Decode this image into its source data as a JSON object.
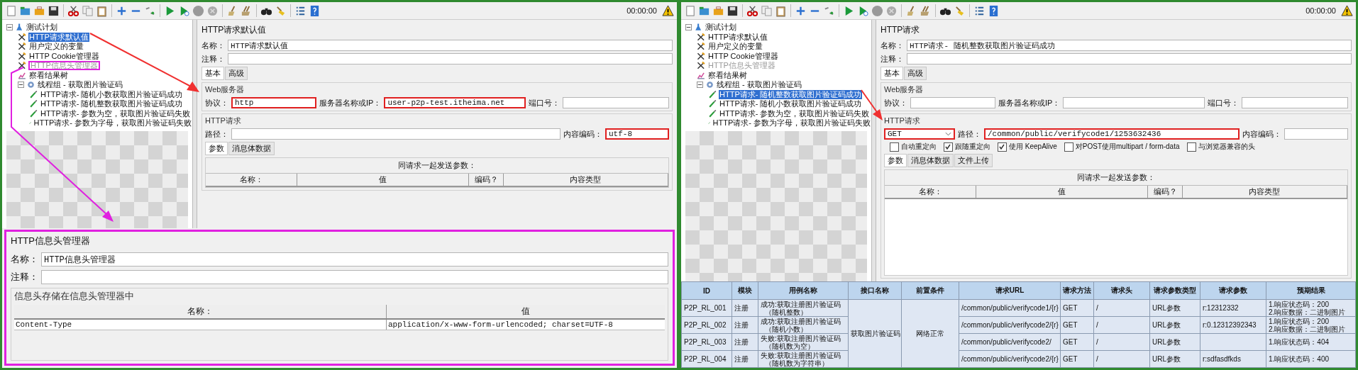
{
  "windows": [
    {
      "toolbar": {
        "timer": "00:00:00"
      },
      "tree": [
        {
          "label": "测试计划",
          "kind": "plan",
          "expanded": true,
          "selected": false,
          "disabled": false,
          "highlighted": false,
          "children": [
            {
              "label": "HTTP请求默认值",
              "kind": "config",
              "selected": true,
              "disabled": false,
              "highlighted": false
            },
            {
              "label": "用户定义的变量",
              "kind": "config",
              "selected": false,
              "disabled": false,
              "highlighted": false
            },
            {
              "label": "HTTP Cookie管理器",
              "kind": "config",
              "selected": false,
              "disabled": false,
              "highlighted": false
            },
            {
              "label": "HTTP信息头管理器",
              "kind": "config",
              "selected": false,
              "disabled": true,
              "highlighted": true
            },
            {
              "label": "察看结果树",
              "kind": "listener",
              "selected": false,
              "disabled": false,
              "highlighted": false
            },
            {
              "label": "线程组 - 获取图片验证码",
              "kind": "thread_group",
              "expanded": true,
              "selected": false,
              "disabled": false,
              "highlighted": false,
              "children": [
                {
                  "label": "HTTP请求- 随机小数获取图片验证码成功",
                  "kind": "sampler",
                  "selected": false,
                  "disabled": false,
                  "highlighted": false
                },
                {
                  "label": "HTTP请求- 随机整数获取图片验证码成功",
                  "kind": "sampler",
                  "selected": false,
                  "disabled": false,
                  "highlighted": false
                },
                {
                  "label": "HTTP请求- 参数为空，获取图片验证码失败",
                  "kind": "sampler",
                  "selected": false,
                  "disabled": false,
                  "highlighted": false
                },
                {
                  "label": "HTTP请求- 参数为字母，获取图片验证码失败",
                  "kind": "sampler",
                  "selected": false,
                  "disabled": false,
                  "highlighted": false
                }
              ]
            }
          ]
        }
      ],
      "editor": {
        "title": "HTTP请求默认值",
        "name_label": "名称：",
        "name_value": "HTTP请求默认值",
        "comment_label": "注释：",
        "tabs": [
          {
            "label": "基本",
            "selected": true
          },
          {
            "label": "高级",
            "selected": false
          }
        ],
        "web_server": {
          "legend": "Web服务器",
          "fields": [
            {
              "label": "协议：",
              "value": "http",
              "highlighted": true
            },
            {
              "label": "服务器名称或IP：",
              "value": "user-p2p-test.itheima.net",
              "highlighted": true
            },
            {
              "label": "端口号：",
              "highlighted": false
            }
          ]
        },
        "http_request": {
          "legend": "HTTP请求",
          "path": {
            "label": "路径：",
            "highlighted": false
          },
          "encoding": {
            "label": "内容编码：",
            "value": "utf-8",
            "highlighted": true
          }
        },
        "param_tabs": [
          {
            "label": "参数",
            "selected": true
          },
          {
            "label": "消息体数据",
            "selected": false
          }
        ],
        "params_table": {
          "caption": "同请求一起发送参数：",
          "columns": [
            "名称：",
            "值",
            "编码？",
            "内容类型"
          ]
        }
      },
      "header_manager": {
        "highlighted": true,
        "title": "HTTP信息头管理器",
        "name_label": "名称：",
        "name_value": "HTTP信息头管理器",
        "comment_label": "注释：",
        "legend": "信息头存储在信息头管理器中",
        "columns": [
          "名称：",
          "值"
        ],
        "rows": [
          [
            "Content-Type",
            "application/x-www-form-urlencoded; charset=UTF-8"
          ]
        ]
      }
    },
    {
      "toolbar": {
        "timer": "00:00:00"
      },
      "tree": [
        {
          "label": "测试计划",
          "kind": "plan",
          "expanded": true,
          "selected": false,
          "disabled": false,
          "highlighted": false,
          "children": [
            {
              "label": "HTTP请求默认值",
              "kind": "config",
              "selected": false,
              "disabled": false,
              "highlighted": false
            },
            {
              "label": "用户定义的变量",
              "kind": "config",
              "selected": false,
              "disabled": false,
              "highlighted": false
            },
            {
              "label": "HTTP Cookie管理器",
              "kind": "config",
              "selected": false,
              "disabled": false,
              "highlighted": false
            },
            {
              "label": "HTTP信息头管理器",
              "kind": "config",
              "selected": false,
              "disabled": true,
              "highlighted": false
            },
            {
              "label": "察看结果树",
              "kind": "listener",
              "selected": false,
              "disabled": false,
              "highlighted": false
            },
            {
              "label": "线程组 - 获取图片验证码",
              "kind": "thread_group",
              "expanded": true,
              "selected": false,
              "disabled": false,
              "highlighted": false,
              "children": [
                {
                  "label": "HTTP请求- 随机整数获取图片验证码成功",
                  "kind": "sampler",
                  "selected": true,
                  "disabled": false,
                  "highlighted": false
                },
                {
                  "label": "HTTP请求- 随机小数获取图片验证码成功",
                  "kind": "sampler",
                  "selected": false,
                  "disabled": false,
                  "highlighted": false
                },
                {
                  "label": "HTTP请求- 参数为空，获取图片验证码失败",
                  "kind": "sampler",
                  "selected": false,
                  "disabled": false,
                  "highlighted": false
                },
                {
                  "label": "HTTP请求- 参数为字母，获取图片验证码失败",
                  "kind": "sampler",
                  "selected": false,
                  "disabled": false,
                  "highlighted": false
                }
              ]
            }
          ]
        }
      ],
      "editor": {
        "title": "HTTP请求",
        "name_label": "名称：",
        "name_value": "HTTP请求- 随机整数获取图片验证码成功",
        "comment_label": "注释：",
        "tabs": [
          {
            "label": "基本",
            "selected": true
          },
          {
            "label": "高级",
            "selected": false
          }
        ],
        "web_server": {
          "legend": "Web服务器",
          "fields": [
            {
              "label": "协议：",
              "highlighted": false
            },
            {
              "label": "服务器名称或IP：",
              "highlighted": false
            },
            {
              "label": "端口号：",
              "highlighted": false
            }
          ]
        },
        "http_request": {
          "legend": "HTTP请求",
          "method": {
            "value": "GET",
            "highlighted": true
          },
          "path": {
            "label": "路径：",
            "value": "/common/public/verifycode1/1253632436",
            "highlighted": true
          },
          "encoding": {
            "label": "内容编码：",
            "highlighted": false
          },
          "options": [
            {
              "label": "自动重定向",
              "checked": false
            },
            {
              "label": "跟随重定向",
              "checked": true
            },
            {
              "label": "使用 KeepAlive",
              "checked": true
            },
            {
              "label": "对POST使用multipart / form-data",
              "checked": false
            },
            {
              "label": "与浏览器兼容的头",
              "checked": false
            }
          ]
        },
        "param_tabs": [
          {
            "label": "参数",
            "selected": true
          },
          {
            "label": "消息体数据",
            "selected": false
          },
          {
            "label": "文件上传",
            "selected": false
          }
        ],
        "params_table": {
          "caption": "同请求一起发送参数：",
          "columns": [
            "名称：",
            "值",
            "编码？",
            "内容类型"
          ]
        }
      },
      "test_case_table": {
        "columns": [
          "ID",
          "模块",
          "用例名称",
          "接口名称",
          "前置条件",
          "请求URL",
          "请求方法",
          "请求头",
          "请求参数类型",
          "请求参数",
          "预期结果"
        ],
        "api_name": "获取图片验证码",
        "precondition": "网络正常",
        "rows": [
          {
            "id": "P2P_RL_001",
            "module": "注册",
            "case_name": "成功:获取注册图片验证码",
            "case_note": "（随机整数）",
            "url": "/common/public/verifycode1/{r}",
            "method": "GET",
            "headers": "/",
            "param_type": "URL参数",
            "params": "r:12312332",
            "expected": [
              "1.响应状态码：200",
              "2.响应数据：二进制图片"
            ]
          },
          {
            "id": "P2P_RL_002",
            "module": "注册",
            "case_name": "成功:获取注册图片验证码",
            "case_note": "（随机小数）",
            "url": "/common/public/verifycode2/{r}",
            "method": "GET",
            "headers": "/",
            "param_type": "URL参数",
            "params": "r:0.12312392343",
            "expected": [
              "1.响应状态码：200",
              "2.响应数据：二进制图片"
            ]
          },
          {
            "id": "P2P_RL_003",
            "module": "注册",
            "case_name": "失败:获取注册图片验证码",
            "case_note": "（随机数为空）",
            "url": "/common/public/verifycode2/",
            "method": "GET",
            "headers": "/",
            "param_type": "URL参数",
            "expected": [
              "1.响应状态码：404"
            ]
          },
          {
            "id": "P2P_RL_004",
            "module": "注册",
            "case_name": "失败:获取注册图片验证码",
            "case_note": "（随机数为字符串）",
            "url": "/common/public/verifycode2/{r}",
            "method": "GET",
            "headers": "/",
            "param_type": "URL参数",
            "params": "r:sdfasdfkds",
            "expected": [
              "1.响应状态码：400"
            ]
          }
        ]
      }
    }
  ]
}
